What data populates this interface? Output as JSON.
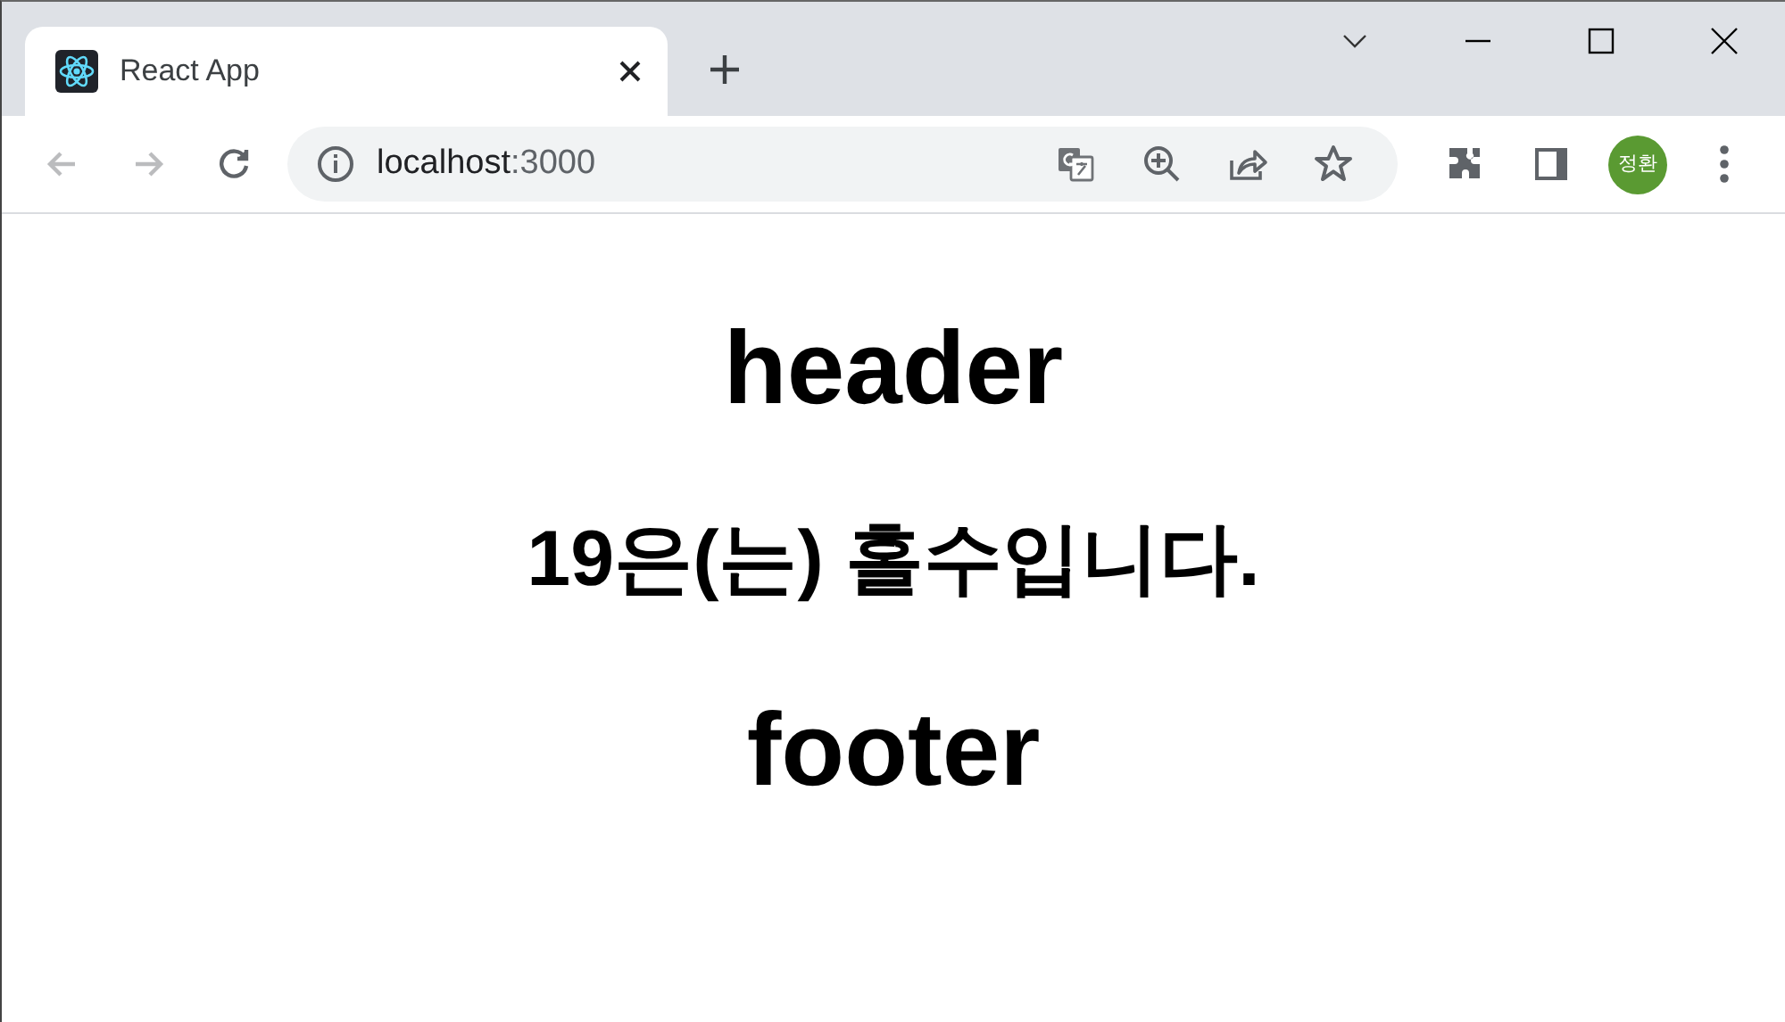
{
  "tabs": [
    {
      "title": "React App",
      "selected": true
    }
  ],
  "address_bar": {
    "host": "localhost",
    "port": ":3000"
  },
  "nav_buttons": [
    {
      "kind": "back",
      "disabled": true
    },
    {
      "kind": "forward",
      "disabled": true
    },
    {
      "kind": "reload",
      "disabled": false
    }
  ],
  "profile": {
    "initials": "정환"
  },
  "page": {
    "header": "header",
    "message": "19은(는) 홀수입니다.",
    "footer": "footer"
  }
}
